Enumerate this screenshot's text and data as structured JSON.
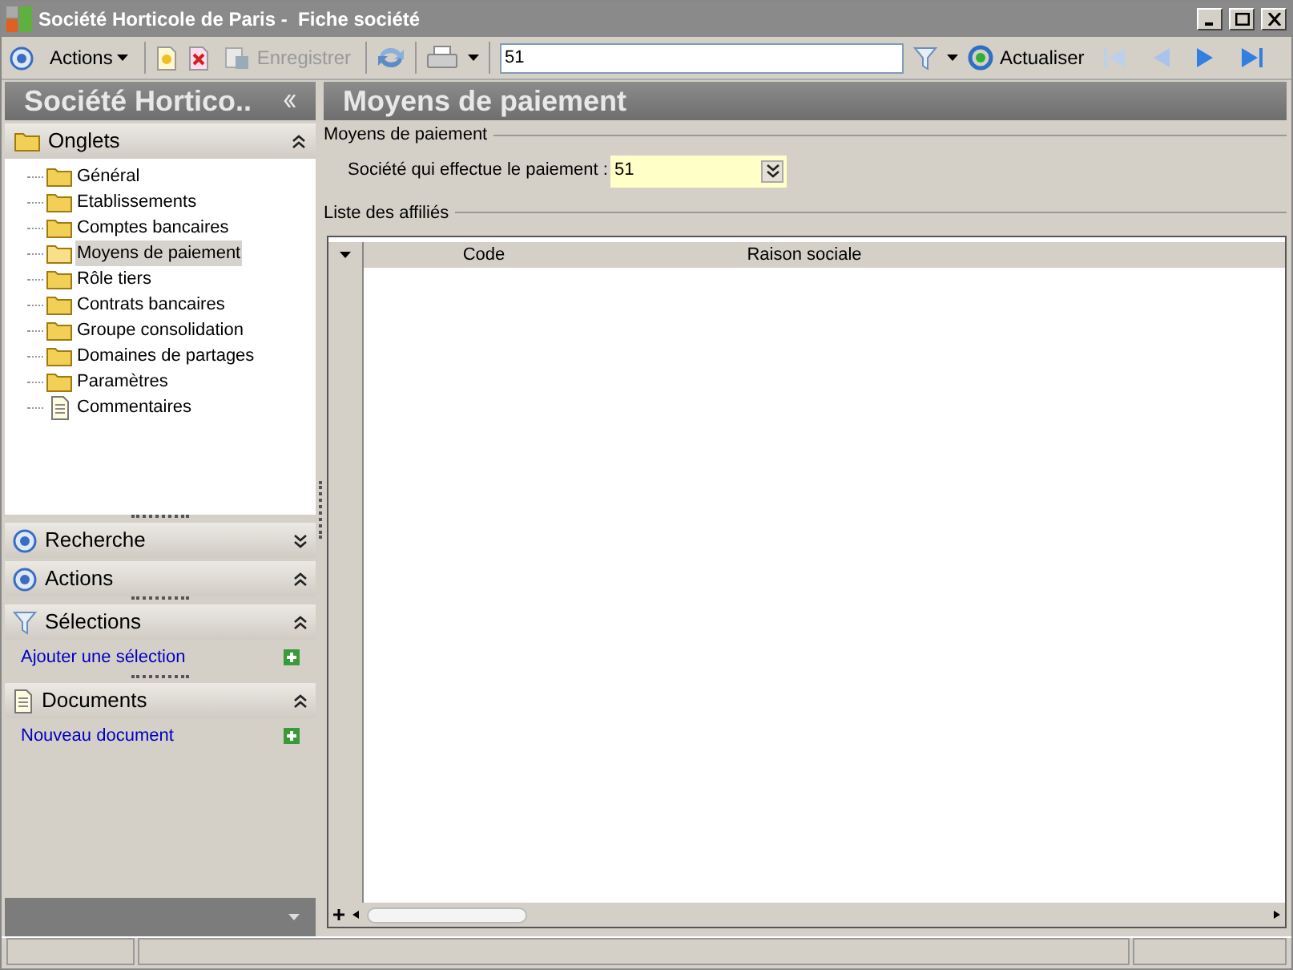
{
  "window": {
    "title": "Société Horticole de Paris -  Fiche société"
  },
  "toolbar": {
    "actions": "Actions",
    "save": {
      "label": "Enregistrer",
      "disabled": true
    },
    "search": {
      "value": "51"
    },
    "refresh": "Actualiser"
  },
  "sidebar": {
    "title": "Société Hortico..",
    "tabs_panel": {
      "label": "Onglets",
      "expanded": true,
      "items": [
        {
          "label": "Général",
          "kind": "folder",
          "selected": false
        },
        {
          "label": "Etablissements",
          "kind": "folder",
          "selected": false
        },
        {
          "label": "Comptes bancaires",
          "kind": "folder",
          "selected": false
        },
        {
          "label": "Moyens de paiement",
          "kind": "folder",
          "selected": true
        },
        {
          "label": "Rôle tiers",
          "kind": "folder",
          "selected": false
        },
        {
          "label": "Contrats bancaires",
          "kind": "folder",
          "selected": false
        },
        {
          "label": "Groupe consolidation",
          "kind": "folder",
          "selected": false
        },
        {
          "label": "Domaines de partages",
          "kind": "folder",
          "selected": false
        },
        {
          "label": "Paramètres",
          "kind": "folder",
          "selected": false
        },
        {
          "label": "Commentaires",
          "kind": "document",
          "selected": false
        }
      ]
    },
    "panels": [
      {
        "label": "Recherche",
        "kind": "target",
        "expanded": false
      },
      {
        "label": "Actions",
        "kind": "target",
        "expanded": true
      },
      {
        "label": "Sélections",
        "kind": "filter",
        "expanded": true,
        "link": "Ajouter une sélection"
      },
      {
        "label": "Documents",
        "kind": "document",
        "expanded": true,
        "link": "Nouveau document"
      }
    ]
  },
  "content": {
    "title": "Moyens de paiement",
    "section": "Moyens de paiement",
    "field": {
      "label": "Société qui effectue le paiement :",
      "value": "51"
    },
    "list_title": "Liste des affiliés",
    "table": {
      "columns": [
        "Code",
        "Raison sociale"
      ]
    }
  }
}
